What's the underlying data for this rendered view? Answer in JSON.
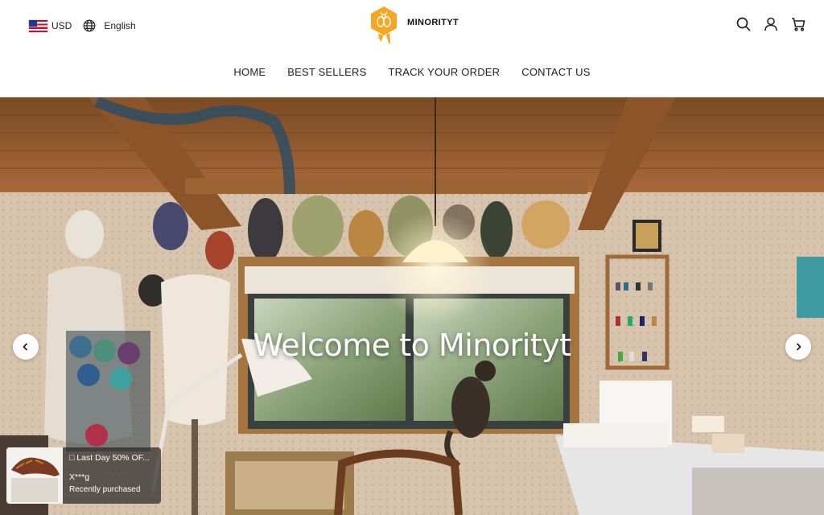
{
  "header": {
    "currency": "USD",
    "language": "English",
    "brand": "MINORITYT",
    "icons": [
      "search-icon",
      "user-icon",
      "cart-icon"
    ],
    "brand_color": "#f5a623"
  },
  "nav": {
    "items": [
      "HOME",
      "BEST SELLERS",
      "TRACK YOUR ORDER",
      "CONTACT US"
    ]
  },
  "hero": {
    "title": "Welcome to Minorityt"
  },
  "popup": {
    "title": "□ Last Day 50% OF...",
    "buyer": "X***g",
    "status": "Recently purchased"
  }
}
